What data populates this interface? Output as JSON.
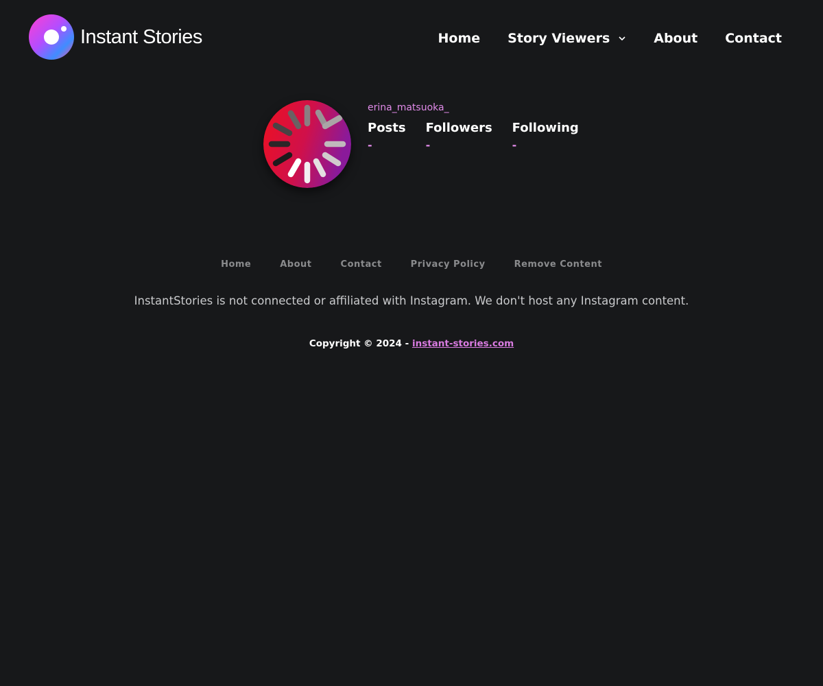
{
  "header": {
    "logo_text": "Instant Stories",
    "nav": [
      {
        "label": "Home"
      },
      {
        "label": "Story Viewers"
      },
      {
        "label": "About"
      },
      {
        "label": "Contact"
      }
    ]
  },
  "profile": {
    "username": "erina_matsuoka_",
    "stats": [
      {
        "label": "Posts",
        "value": "-"
      },
      {
        "label": "Followers",
        "value": "-"
      },
      {
        "label": "Following",
        "value": "-"
      }
    ]
  },
  "footer": {
    "links": [
      {
        "label": "Home"
      },
      {
        "label": "About"
      },
      {
        "label": "Contact"
      },
      {
        "label": "Privacy Policy"
      },
      {
        "label": "Remove Content"
      }
    ],
    "disclaimer": "InstantStories is not connected or affiliated with Instagram. We don't host any Instagram content.",
    "copyright_prefix": "Copyright © 2024 - ",
    "copyright_link": "instant-stories.com"
  },
  "colors": {
    "background": "#17181a",
    "accent": "#e08ae8",
    "muted": "#8a8b8d",
    "text": "#ffffff"
  },
  "icons": {
    "logo": "camera-lens-icon",
    "dropdown": "chevron-down-icon",
    "avatar": "loading-spinner-icon"
  }
}
